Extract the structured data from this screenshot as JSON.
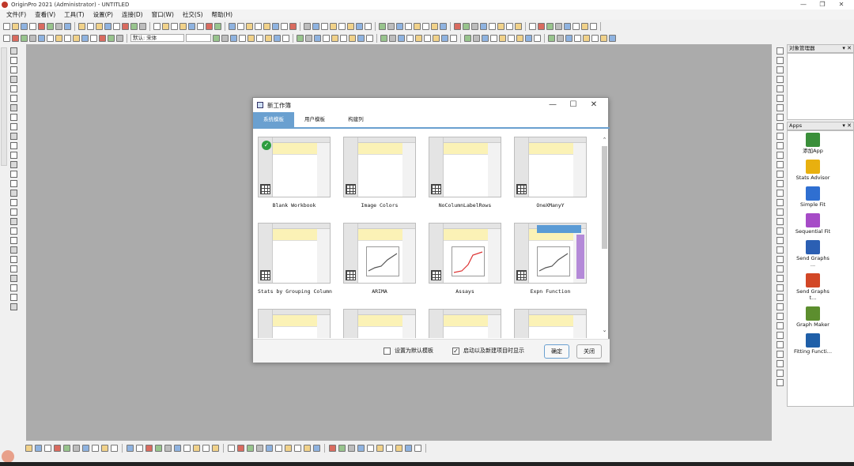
{
  "window": {
    "title": "OriginPro 2021 (Administrator) - UNTITLED",
    "controls": [
      "—",
      "❐",
      "✕"
    ]
  },
  "menu": [
    "文件(F)",
    "查看(V)",
    "工具(T)",
    "设置(P)",
    "连接(D)",
    "窗口(W)",
    "社交(S)",
    "帮助(H)"
  ],
  "toolbar": {
    "font_label": "默认: 宋体"
  },
  "panels": {
    "object_manager": {
      "title": "对象管理器",
      "controls": "▾ ✕"
    },
    "apps": {
      "title": "Apps",
      "controls": "▾ ✕"
    }
  },
  "apps": [
    {
      "name": "添加App",
      "icon": "add-app-icon",
      "color": "#3a8f3a"
    },
    {
      "name": "Stats Advisor",
      "icon": "stats-advisor-icon",
      "color": "#e8b00f"
    },
    {
      "name": "Simple Fit",
      "icon": "simple-fit-icon",
      "color": "#2f6fd1"
    },
    {
      "name": "Sequential Fit",
      "icon": "sequential-fit-icon",
      "color": "#a64bc7"
    },
    {
      "name": "Send Graphs ...",
      "icon": "send-graphs-word-icon",
      "color": "#2b5fb3"
    },
    {
      "name": "Send Graphs t...",
      "icon": "send-graphs-ppt-icon",
      "color": "#d24726"
    },
    {
      "name": "Graph Maker",
      "icon": "graph-maker-icon",
      "color": "#5c8e2e"
    },
    {
      "name": "Fitting Functi...",
      "icon": "fitting-functions-icon",
      "color": "#1f5fa8"
    }
  ],
  "dialog": {
    "title": "新工作簿",
    "controls": [
      "—",
      "☐",
      "✕"
    ],
    "tabs": [
      {
        "label": "系统模板",
        "active": true
      },
      {
        "label": "用户模板",
        "active": false
      },
      {
        "label": "构建列",
        "active": false
      }
    ],
    "templates": [
      {
        "name": "Blank Workbook",
        "selected": true
      },
      {
        "name": "Image Colors"
      },
      {
        "name": "NoColumnLabelRows"
      },
      {
        "name": "OneXManyY"
      },
      {
        "name": "Stats by Grouping Column"
      },
      {
        "name": "ARIMA"
      },
      {
        "name": "Assays"
      },
      {
        "name": "Expn Function"
      },
      {
        "name": ""
      },
      {
        "name": ""
      },
      {
        "name": ""
      },
      {
        "name": ""
      }
    ],
    "set_default_label": "设置为默认模板",
    "set_default_checked": false,
    "show_on_startup_label": "启动以及新建项目时显示",
    "show_on_startup_checked": true,
    "ok_label": "确定",
    "close_label": "关闭"
  }
}
